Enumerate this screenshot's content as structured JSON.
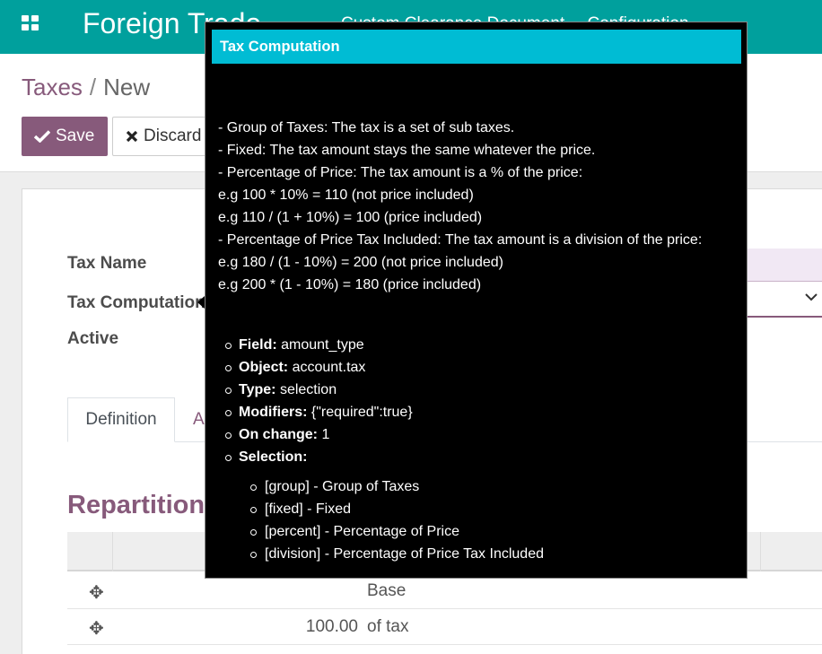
{
  "navbar": {
    "app_name": "Foreign Trade",
    "menu": [
      "Custom Clearance Document",
      "Configuration"
    ]
  },
  "breadcrumb": {
    "parent": "Taxes",
    "separator": "/",
    "current": "New"
  },
  "buttons": {
    "save": "Save",
    "discard": "Discard"
  },
  "form": {
    "tax_name_label": "Tax Name",
    "tax_computation_label": "Tax Computation",
    "active_label": "Active",
    "tabs": {
      "active": "Definition",
      "other": "A"
    },
    "section_title": "Repartition f"
  },
  "table": {
    "rows": [
      {
        "amount": "",
        "label": "Base"
      },
      {
        "amount": "100.00",
        "label": "of tax"
      }
    ]
  },
  "tooltip": {
    "title": "Tax Computation",
    "help_lines": [
      "- Group of Taxes: The tax is a set of sub taxes.",
      "- Fixed: The tax amount stays the same whatever the price.",
      "- Percentage of Price: The tax amount is a % of the price:",
      "e.g 100 * 10% = 110 (not price included)",
      "e.g 110 / (1 + 10%) = 100 (price included)",
      "- Percentage of Price Tax Included: The tax amount is a division of the price:",
      "e.g 180 / (1 - 10%) = 200 (not price included)",
      "e.g 200 * (1 - 10%) = 180 (price included)"
    ],
    "meta": [
      {
        "key": "Field:",
        "value": "amount_type"
      },
      {
        "key": "Object:",
        "value": "account.tax"
      },
      {
        "key": "Type:",
        "value": "selection"
      },
      {
        "key": "Modifiers:",
        "value": "{\"required\":true}"
      },
      {
        "key": "On change:",
        "value": "1"
      },
      {
        "key": "Selection:",
        "value": ""
      }
    ],
    "selection": [
      "[group] - Group of Taxes",
      "[fixed] - Fixed",
      "[percent] - Percentage of Price",
      "[division] - Percentage of Price Tax Included"
    ]
  },
  "colors": {
    "navbar": "#00a09d",
    "primary": "#875a7b",
    "tooltip_header": "#00bcd4",
    "tooltip_bg": "#000000"
  },
  "icons": {
    "apps": "apps-grid-icon",
    "save": "check-icon",
    "discard": "times-icon",
    "select": "chevron-down-icon",
    "row_handle": "arrows-move-icon"
  }
}
